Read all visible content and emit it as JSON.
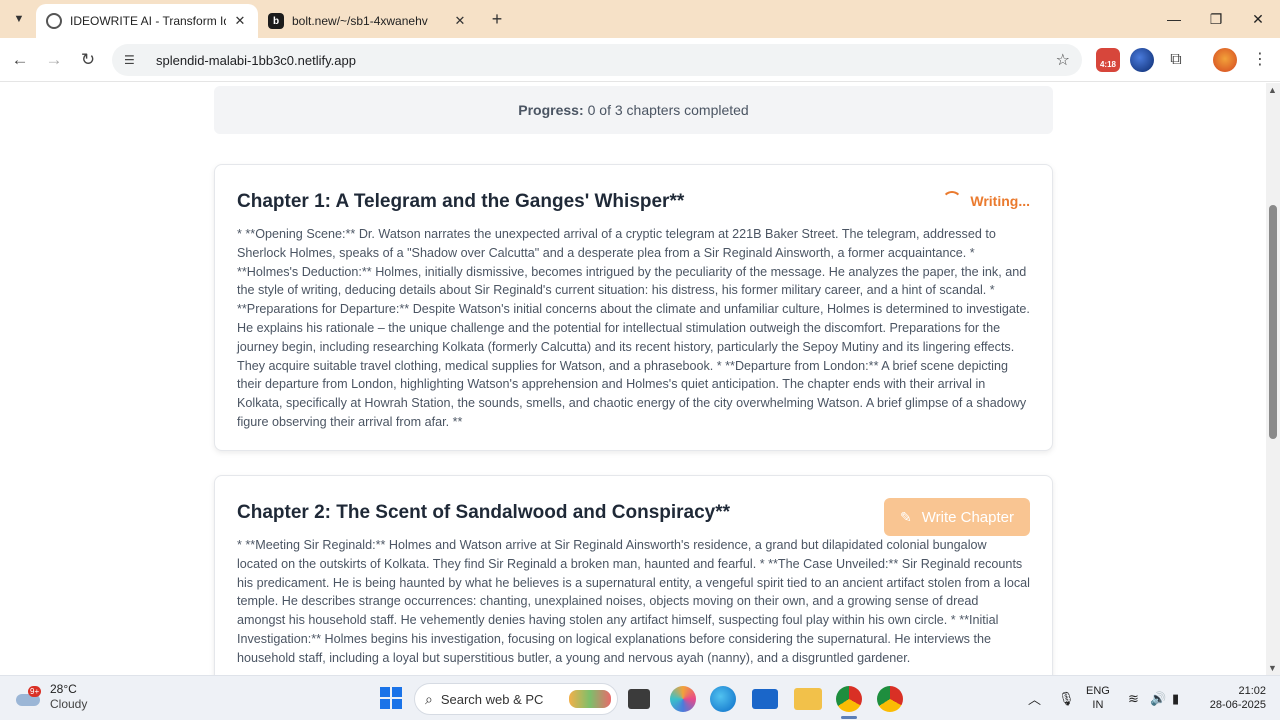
{
  "browser": {
    "tabs": [
      {
        "title": "IDEOWRITE AI - Transform Idea",
        "active": true
      },
      {
        "title": "bolt.new/~/sb1-4xwanehv",
        "active": false
      }
    ],
    "url": "splendid-malabi-1bb3c0.netlify.app",
    "timer_badge": "4:18"
  },
  "page": {
    "progress_label": "Progress:",
    "progress_text": "0 of 3 chapters completed",
    "chapters": [
      {
        "title": "Chapter 1: A Telegram and the Ganges' Whisper**",
        "status": "Writing...",
        "summary": "* **Opening Scene:** Dr. Watson narrates the unexpected arrival of a cryptic telegram at 221B Baker Street. The telegram, addressed to Sherlock Holmes, speaks of a \"Shadow over Calcutta\" and a desperate plea from a Sir Reginald Ainsworth, a former acquaintance. * **Holmes's Deduction:** Holmes, initially dismissive, becomes intrigued by the peculiarity of the message. He analyzes the paper, the ink, and the style of writing, deducing details about Sir Reginald's current situation: his distress, his former military career, and a hint of scandal. * **Preparations for Departure:** Despite Watson's initial concerns about the climate and unfamiliar culture, Holmes is determined to investigate. He explains his rationale – the unique challenge and the potential for intellectual stimulation outweigh the discomfort. Preparations for the journey begin, including researching Kolkata (formerly Calcutta) and its recent history, particularly the Sepoy Mutiny and its lingering effects. They acquire suitable travel clothing, medical supplies for Watson, and a phrasebook. * **Departure from London:** A brief scene depicting their departure from London, highlighting Watson's apprehension and Holmes's quiet anticipation. The chapter ends with their arrival in Kolkata, specifically at Howrah Station, the sounds, smells, and chaotic energy of the city overwhelming Watson. A brief glimpse of a shadowy figure observing their arrival from afar. **"
      },
      {
        "title": "Chapter 2: The Scent of Sandalwood and Conspiracy**",
        "button": "Write Chapter",
        "summary": "* **Meeting Sir Reginald:** Holmes and Watson arrive at Sir Reginald Ainsworth's residence, a grand but dilapidated colonial bungalow located on the outskirts of Kolkata. They find Sir Reginald a broken man, haunted and fearful. * **The Case Unveiled:** Sir Reginald recounts his predicament. He is being haunted by what he believes is a supernatural entity, a vengeful spirit tied to an ancient artifact stolen from a local temple. He describes strange occurrences: chanting, unexplained noises, objects moving on their own, and a growing sense of dread amongst his household staff. He vehemently denies having stolen any artifact himself, suspecting foul play within his own circle. * **Initial Investigation:** Holmes begins his investigation, focusing on logical explanations before considering the supernatural. He interviews the household staff, including a loyal but superstitious butler, a young and nervous ayah (nanny), and a disgruntled gardener."
      }
    ]
  },
  "taskbar": {
    "weather_badge": "9+",
    "temperature": "28°C",
    "condition": "Cloudy",
    "search_placeholder": "Search web & PC",
    "lang_line1": "ENG",
    "lang_line2": "IN",
    "time": "21:02",
    "date": "28-06-2025"
  },
  "colors": {
    "accent": "#ea7a2e",
    "button_disabled": "#f9c592",
    "tabstrip": "#f6e1c7"
  }
}
